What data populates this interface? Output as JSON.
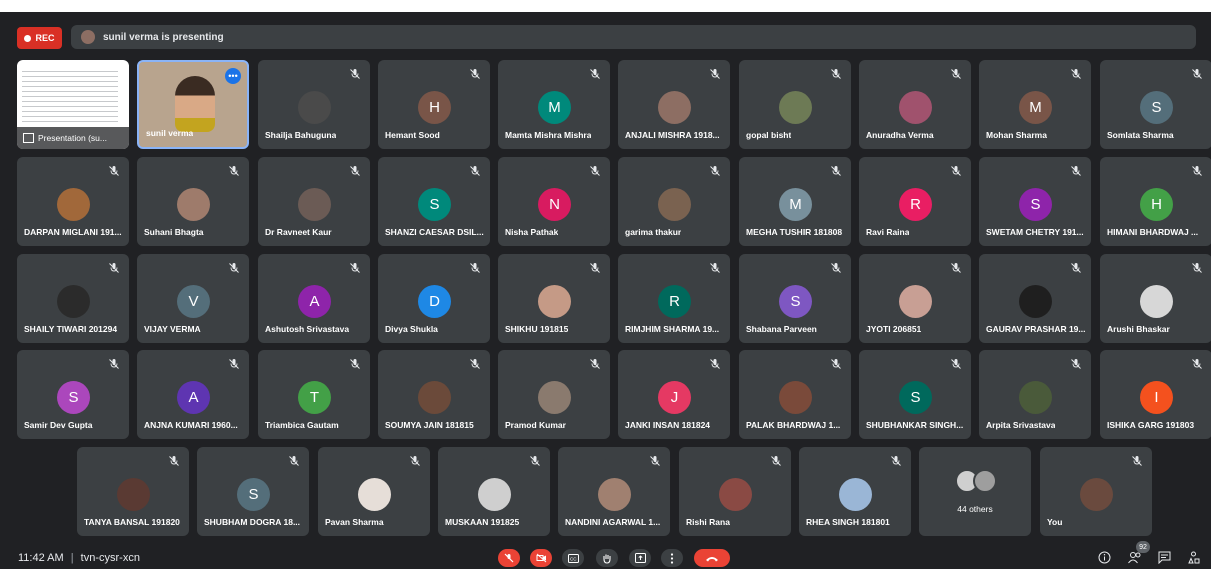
{
  "meeting": {
    "rec_label": "REC",
    "presenting_text": "sunil verma is presenting",
    "time": "11:42 AM",
    "separator": "|",
    "code": "tvn-cysr-xcn",
    "participant_badge": "92"
  },
  "tiles": {
    "presentation_label": "Presentation (su...",
    "speaker_name": "sunil verma",
    "others_label": "44 others",
    "people": [
      {
        "name": "Shailja Bahuguna",
        "type": "photo",
        "color": "#4a4a4a"
      },
      {
        "name": "Hemant Sood",
        "type": "letter",
        "letter": "H",
        "color": "#795548"
      },
      {
        "name": "Mamta Mishra Mishra",
        "type": "letter",
        "letter": "M",
        "color": "#00897b"
      },
      {
        "name": "ANJALI MISHRA 1918...",
        "type": "photo",
        "color": "#8d6e63"
      },
      {
        "name": "gopal bisht",
        "type": "photo",
        "color": "#6d7a55"
      },
      {
        "name": "Anuradha Verma",
        "type": "photo",
        "color": "#a0526d"
      },
      {
        "name": "Mohan Sharma",
        "type": "letter",
        "letter": "M",
        "color": "#795548"
      },
      {
        "name": "Somlata Sharma",
        "type": "letter",
        "letter": "S",
        "color": "#546e7a"
      },
      {
        "name": "DARPAN MIGLANI 191...",
        "type": "photo",
        "color": "#a1683a"
      },
      {
        "name": "Suhani Bhagta",
        "type": "photo",
        "color": "#9e7b6b"
      },
      {
        "name": "Dr Ravneet Kaur",
        "type": "photo",
        "color": "#6b5b55"
      },
      {
        "name": "SHANZI CAESAR DSIL...",
        "type": "letter",
        "letter": "S",
        "color": "#00897b"
      },
      {
        "name": "Nisha Pathak",
        "type": "letter",
        "letter": "N",
        "color": "#d81b60"
      },
      {
        "name": "garima thakur",
        "type": "photo",
        "color": "#7a6250"
      },
      {
        "name": "MEGHA TUSHIR 181808",
        "type": "letter",
        "letter": "M",
        "color": "#78909c"
      },
      {
        "name": "Ravi Raina",
        "type": "letter",
        "letter": "R",
        "color": "#e91e63"
      },
      {
        "name": "SWETAM CHETRY 191...",
        "type": "letter",
        "letter": "S",
        "color": "#8e24aa"
      },
      {
        "name": "HIMANI BHARDWAJ ...",
        "type": "letter",
        "letter": "H",
        "color": "#43a047"
      },
      {
        "name": "SHAILY TIWARI 201294",
        "type": "photo",
        "color": "#2b2b2b"
      },
      {
        "name": "VIJAY VERMA",
        "type": "letter",
        "letter": "V",
        "color": "#546e7a"
      },
      {
        "name": "Ashutosh Srivastava",
        "type": "letter",
        "letter": "A",
        "color": "#8e24aa"
      },
      {
        "name": "Divya Shukla",
        "type": "letter",
        "letter": "D",
        "color": "#1e88e5"
      },
      {
        "name": "SHIKHU 191815",
        "type": "photo",
        "color": "#c59a86"
      },
      {
        "name": "RIMJHIM SHARMA 19...",
        "type": "letter",
        "letter": "R",
        "color": "#00695c"
      },
      {
        "name": "Shabana Parveen",
        "type": "letter",
        "letter": "S",
        "color": "#7e57c2"
      },
      {
        "name": "JYOTI 206851",
        "type": "photo",
        "color": "#c89f94"
      },
      {
        "name": "GAURAV PRASHAR 19...",
        "type": "photo",
        "color": "#1f1f1f"
      },
      {
        "name": "Arushi Bhaskar",
        "type": "photo",
        "color": "#d7d7d7"
      },
      {
        "name": "Samir Dev Gupta",
        "type": "letter",
        "letter": "S",
        "color": "#ab47bc"
      },
      {
        "name": "ANJNA KUMARI 1960...",
        "type": "letter",
        "letter": "A",
        "color": "#5e35b1"
      },
      {
        "name": "Triambica Gautam",
        "type": "letter",
        "letter": "T",
        "color": "#43a047"
      },
      {
        "name": "SOUMYA JAIN 181815",
        "type": "photo",
        "color": "#6b4a3a"
      },
      {
        "name": "Pramod Kumar",
        "type": "photo",
        "color": "#8a7a6e"
      },
      {
        "name": "JANKI INSAN 181824",
        "type": "letter",
        "letter": "J",
        "color": "#e53963"
      },
      {
        "name": "PALAK BHARDWAJ 1...",
        "type": "photo",
        "color": "#7a4a3a"
      },
      {
        "name": "SHUBHANKAR SINGH...",
        "type": "letter",
        "letter": "S",
        "color": "#00695c"
      },
      {
        "name": "Arpita Srivastava",
        "type": "photo",
        "color": "#4a5a3a"
      },
      {
        "name": "ISHIKA GARG 191803",
        "type": "letter",
        "letter": "I",
        "color": "#f4511e"
      },
      {
        "name": "TANYA BANSAL 191820",
        "type": "photo",
        "color": "#5a3a33"
      },
      {
        "name": "SHUBHAM DOGRA 18...",
        "type": "letter",
        "letter": "S",
        "color": "#546e7a"
      },
      {
        "name": "Pavan Sharma",
        "type": "photo",
        "color": "#e6ded8"
      },
      {
        "name": "MUSKAAN 191825",
        "type": "photo",
        "color": "#cfcfcf"
      },
      {
        "name": "NANDINI AGARWAL 1...",
        "type": "photo",
        "color": "#a08070"
      },
      {
        "name": "Rishi Rana",
        "type": "photo",
        "color": "#8a4a44"
      },
      {
        "name": "RHEA SINGH 181801",
        "type": "photo",
        "color": "#9ab6d6"
      },
      {
        "name": "You",
        "type": "photo",
        "color": "#6a4a3e"
      }
    ]
  },
  "icons": {
    "mic_off": "mic-off-icon",
    "cam_off": "camera-off-icon",
    "captions": "captions-icon",
    "hand": "raise-hand-icon",
    "present": "present-icon",
    "more": "more-icon",
    "end": "end-call-icon",
    "info": "info-icon",
    "people": "people-icon",
    "chat": "chat-icon",
    "activities": "activities-icon"
  },
  "colors": {
    "background": "#202124",
    "tile": "#3c4043",
    "red": "#ea4335",
    "rec": "#d93025",
    "speaker_border": "#8ab4f8"
  }
}
